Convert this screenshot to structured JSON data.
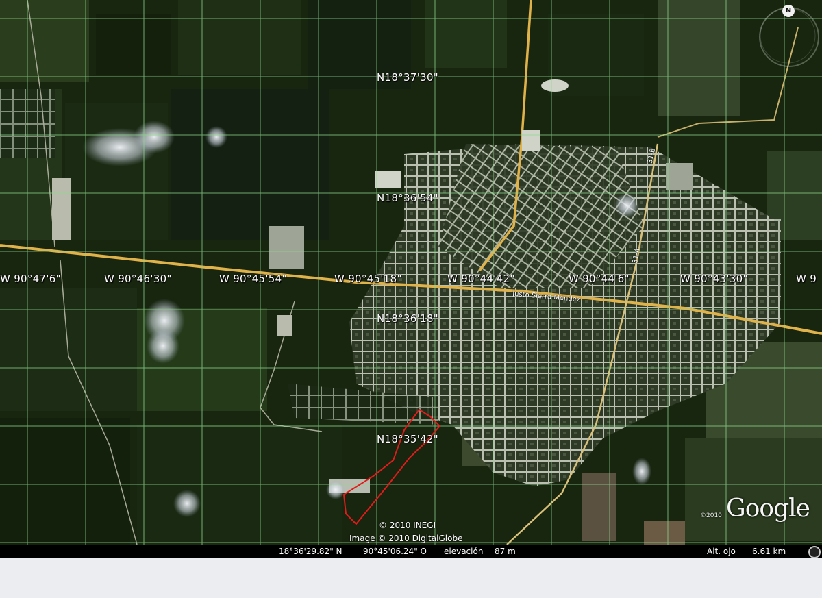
{
  "grid": {
    "latitude_labels": [
      "N18°37'30\"",
      "N18°36'54\"",
      "N18°36'18\"",
      "N18°35'42\""
    ],
    "longitude_labels": [
      "W 90°47'6\"",
      "W 90°46'30\"",
      "W 90°45'54\"",
      "W 90°45'18\"",
      "W 90°44'42\"",
      "W 90°44'6\"",
      "W 90°43'30\"",
      "W 9"
    ]
  },
  "roads": {
    "main_street": "Justo Sierra Méndez",
    "highway_a": "31-B",
    "highway_b": "31-4"
  },
  "compass": {
    "north": "N"
  },
  "credits": {
    "inegi": "© 2010 INEGI",
    "digitalglobe": "Image © 2010 DigitalGlobe",
    "logo": "Google",
    "logo_year": "©2010"
  },
  "status": {
    "latitude": "18°36'29.82\" N",
    "longitude": "90°45'06.24\" O",
    "elevation_label": "elevación",
    "elevation_value": "87 m",
    "eye_alt_label": "Alt. ojo",
    "eye_alt_value": "6.61 km"
  },
  "colors": {
    "gridline": "#8fd98f",
    "parcel_outline": "#e21b1b",
    "main_road": "#e0b24a",
    "status_bar": "#000000",
    "page_border": "#ecedf0"
  }
}
